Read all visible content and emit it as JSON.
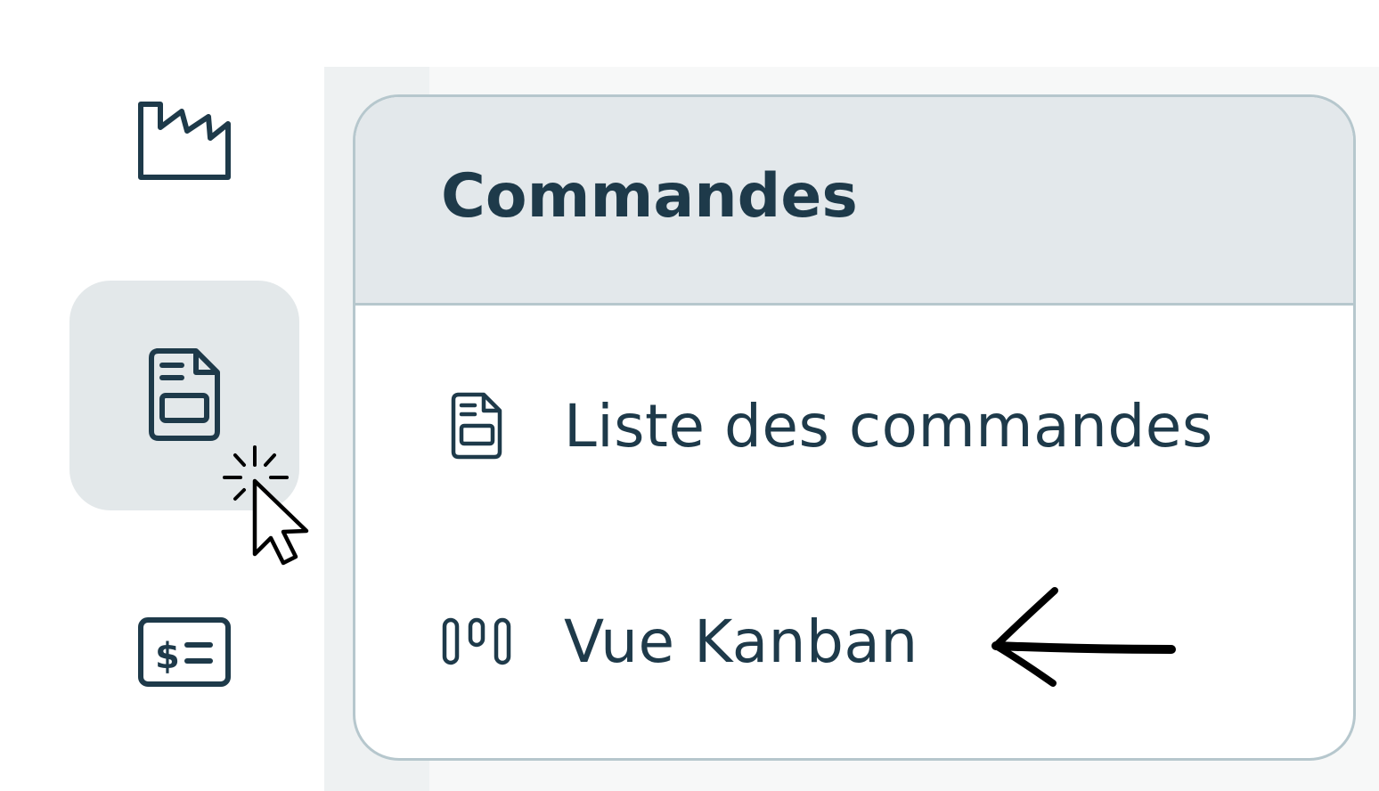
{
  "rail": {
    "items": [
      {
        "icon": "factory-icon",
        "active": false
      },
      {
        "icon": "order-document-icon",
        "active": true
      },
      {
        "icon": "invoice-dollar-icon",
        "active": false
      }
    ]
  },
  "popup": {
    "title": "Commandes",
    "items": [
      {
        "label": "Liste des commandes",
        "icon": "document-list-icon"
      },
      {
        "label": "Vue Kanban",
        "icon": "kanban-columns-icon"
      }
    ]
  },
  "colors": {
    "text": "#1e3a4a",
    "header_bg": "#e3e8eb",
    "border": "#b6c7cd",
    "active_bg": "#e3e8ea"
  }
}
